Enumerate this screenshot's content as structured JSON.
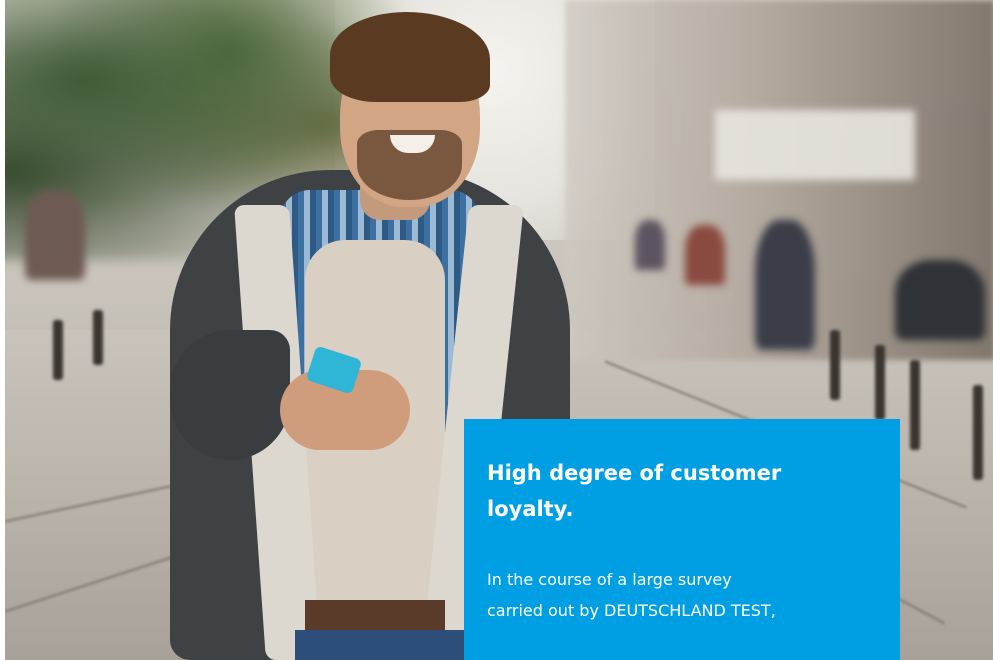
{
  "hero_image": {
    "subject": "man-with-smartphone-on-city-street",
    "accent_color": "#009fe3"
  },
  "info_card": {
    "title_line1": "High degree of customer",
    "title_line2": "loyalty.",
    "body_line1": "In the course of a large survey",
    "body_line2": "carried out by DEUTSCHLAND TEST,"
  }
}
